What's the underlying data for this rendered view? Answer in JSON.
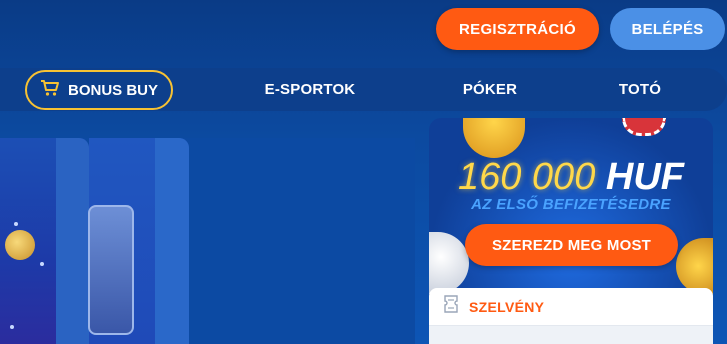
{
  "header": {
    "register_label": "REGISZTRÁCIÓ",
    "login_label": "BELÉPÉS"
  },
  "nav": {
    "items": [
      {
        "label": "BONUS BUY",
        "icon": "cart-icon"
      },
      {
        "label": "E-SPORTOK"
      },
      {
        "label": "PÓKER"
      },
      {
        "label": "TOTÓ"
      }
    ]
  },
  "promo": {
    "amount": "160 000",
    "currency": "HUF",
    "subtitle": "AZ ELSŐ BEFIZETÉSEDRE",
    "cta_label": "SZEREZD MEG MOST"
  },
  "coupon": {
    "title": "SZELVÉNY",
    "icon": "ticket-icon"
  },
  "colors": {
    "accent_orange": "#ff5a12",
    "login_blue": "#4b90e6",
    "bonus_border": "#f7c233",
    "background": "#0c4aa0"
  }
}
